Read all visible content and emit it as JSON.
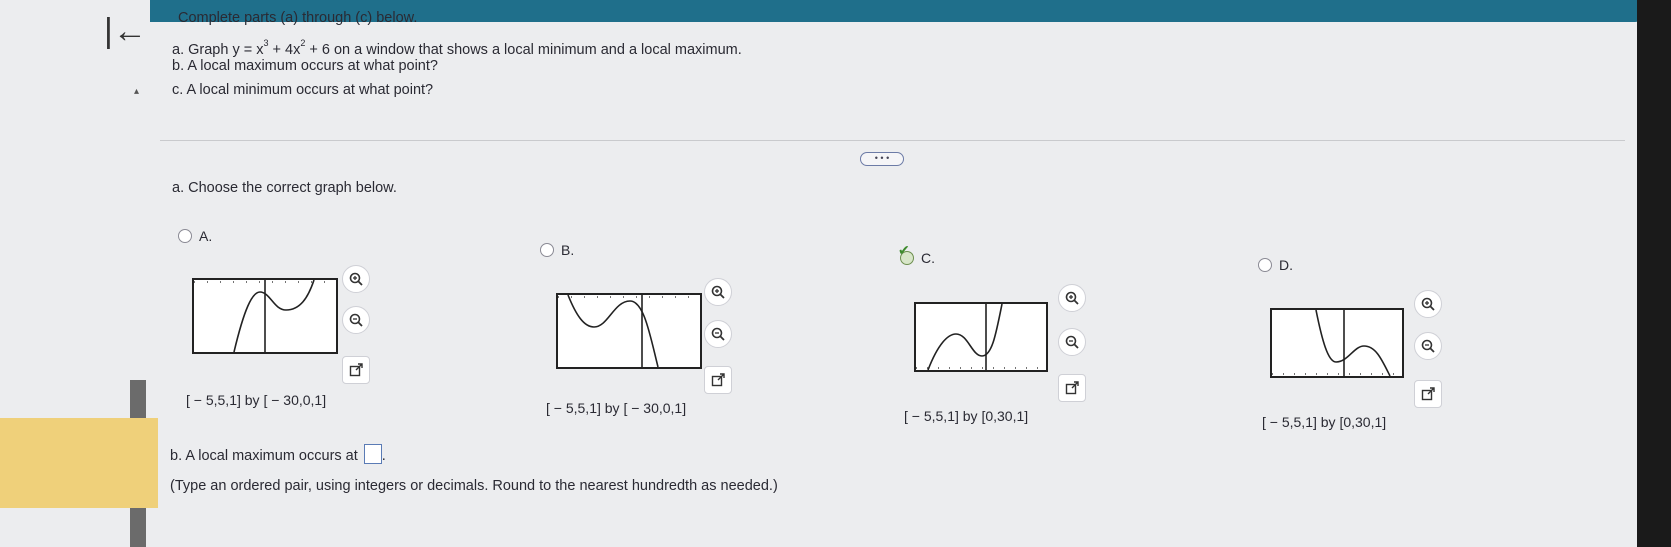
{
  "question": {
    "intro": "Complete parts (a) through (c) below.",
    "part_a_prefix": "a. Graph y = x",
    "part_a_exp1": "3",
    "part_a_mid": " + 4x",
    "part_a_exp2": "2",
    "part_a_suffix": " + 6 on a window that shows a local minimum and a local maximum.",
    "part_b": "b. A local maximum occurs at what point?",
    "part_c": "c. A local minimum occurs at what point?"
  },
  "more_button_label": "• • •",
  "part_a_prompt": "a. Choose the correct graph below.",
  "options": [
    {
      "letter": "A.",
      "window": "[ − 5,5,1] by [ − 30,0,1]",
      "selected": false
    },
    {
      "letter": "B.",
      "window": "[ − 5,5,1] by [ − 30,0,1]",
      "selected": false
    },
    {
      "letter": "C.",
      "window": "[ − 5,5,1] by [0,30,1]",
      "selected": true
    },
    {
      "letter": "D.",
      "window": "[ − 5,5,1] by [0,30,1]",
      "selected": false
    }
  ],
  "part_b_answer": {
    "label": "b. A local maximum occurs at",
    "after": ".",
    "instructions": "(Type an ordered pair, using integers or decimals. Round to the nearest hundredth as needed.)"
  },
  "icons": [
    "back-arrow-icon",
    "zoom-in-icon",
    "zoom-out-icon",
    "popout-icon"
  ],
  "colors": {
    "topbar": "#1f6f8b",
    "accent_yellow": "#efd07a",
    "check_green": "#3e8b2d"
  }
}
